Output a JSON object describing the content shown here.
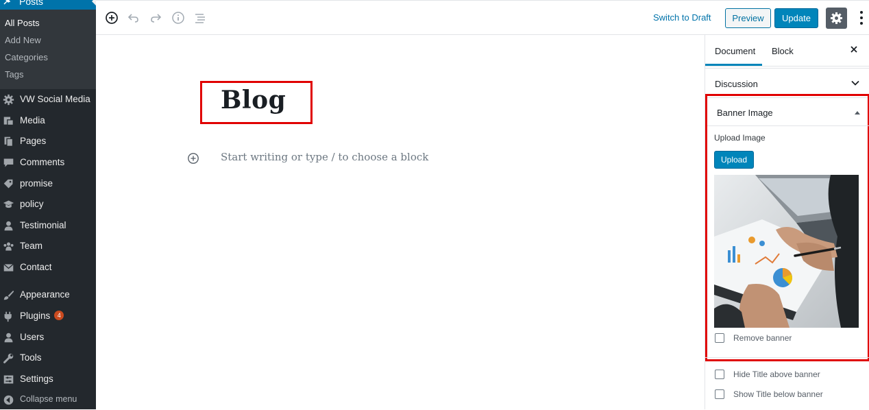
{
  "admin_menu": {
    "posts_label": "Posts",
    "submenu": [
      "All Posts",
      "Add New",
      "Categories",
      "Tags"
    ],
    "items": [
      {
        "label": "VW Social Media",
        "icon": "gear-icon"
      },
      {
        "label": "Media",
        "icon": "media-icon"
      },
      {
        "label": "Pages",
        "icon": "pages-icon"
      },
      {
        "label": "Comments",
        "icon": "comments-icon"
      },
      {
        "label": "promise",
        "icon": "tag-icon"
      },
      {
        "label": "policy",
        "icon": "mortarboard-icon"
      },
      {
        "label": "Testimonial",
        "icon": "person-icon"
      },
      {
        "label": "Team",
        "icon": "groups-icon"
      },
      {
        "label": "Contact",
        "icon": "email-icon"
      },
      {
        "label": "Appearance",
        "icon": "brush-icon"
      },
      {
        "label": "Plugins",
        "icon": "plugin-icon",
        "badge": "4"
      },
      {
        "label": "Users",
        "icon": "users-icon"
      },
      {
        "label": "Tools",
        "icon": "wrench-icon"
      },
      {
        "label": "Settings",
        "icon": "settings-icon"
      },
      {
        "label": "Collapse menu",
        "icon": "collapse-icon"
      }
    ]
  },
  "toolbar": {
    "switch_to_draft": "Switch to Draft",
    "preview": "Preview",
    "update": "Update"
  },
  "editor": {
    "title": "Blog",
    "placeholder": "Start writing or type / to choose a block"
  },
  "sidebar": {
    "tabs": [
      "Document",
      "Block"
    ],
    "discussion": "Discussion",
    "banner": {
      "heading": "Banner Image",
      "upload_label": "Upload Image",
      "upload_button": "Upload",
      "remove_banner": "Remove banner"
    },
    "options": [
      "Hide Title above banner",
      "Show Title below banner"
    ]
  },
  "colors": {
    "admin_bg": "#23282d",
    "admin_submenu_bg": "#32373c",
    "accent": "#0085ba",
    "highlight_border": "#e00000",
    "badge": "#ca4a1f"
  }
}
